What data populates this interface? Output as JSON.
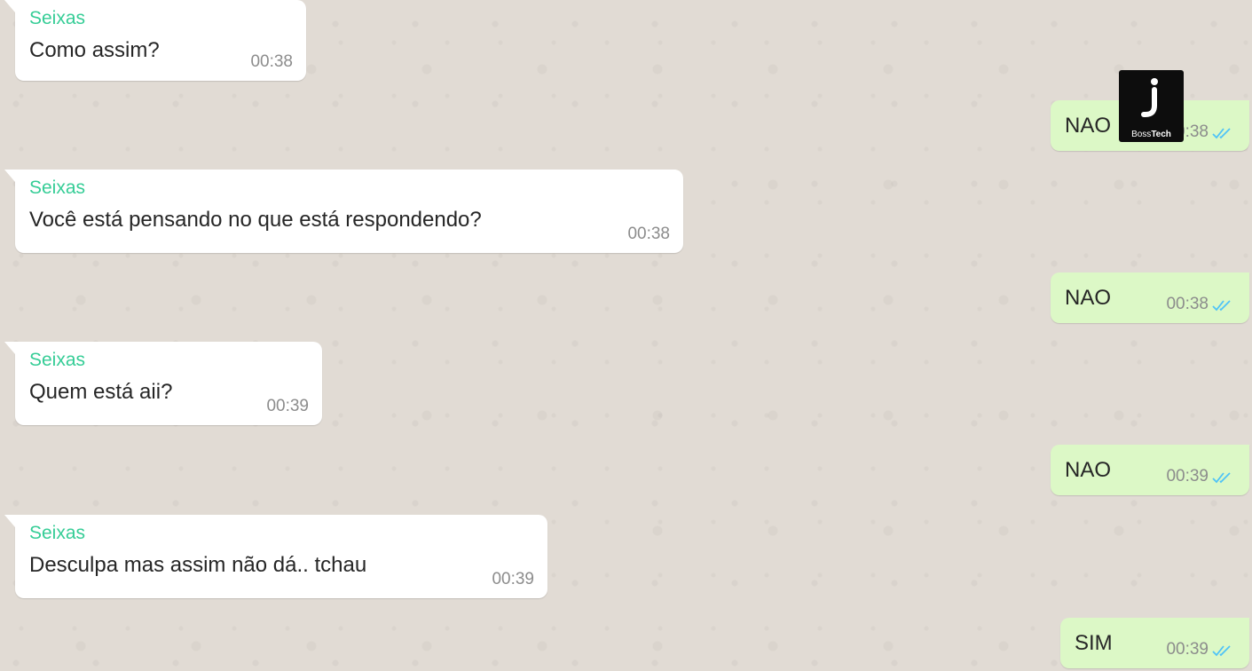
{
  "chat": {
    "messages": [
      {
        "direction": "in",
        "sender": "Seixas",
        "text": "Como assim?",
        "time": "00:38"
      },
      {
        "direction": "out",
        "text": "NAO",
        "time": "00:38",
        "status": "read"
      },
      {
        "direction": "in",
        "sender": "Seixas",
        "text": "Você está pensando no que está respondendo?",
        "time": "00:38"
      },
      {
        "direction": "out",
        "text": "NAO",
        "time": "00:38",
        "status": "read"
      },
      {
        "direction": "in",
        "sender": "Seixas",
        "text": "Quem está aii?",
        "time": "00:39"
      },
      {
        "direction": "out",
        "text": "NAO",
        "time": "00:39",
        "status": "read"
      },
      {
        "direction": "in",
        "sender": "Seixas",
        "text": "Desculpa mas assim não dá.. tchau",
        "time": "00:39"
      },
      {
        "direction": "out",
        "text": "SIM",
        "time": "00:39",
        "status": "read"
      }
    ]
  },
  "watermark": {
    "caption_plain": "Boss",
    "caption_bold": "Tech"
  },
  "colors": {
    "background": "#e1dbd4",
    "incoming_bubble": "#ffffff",
    "outgoing_bubble": "#dcf8c6",
    "sender_name": "#35cd96",
    "read_ticks": "#4fc3f7"
  }
}
